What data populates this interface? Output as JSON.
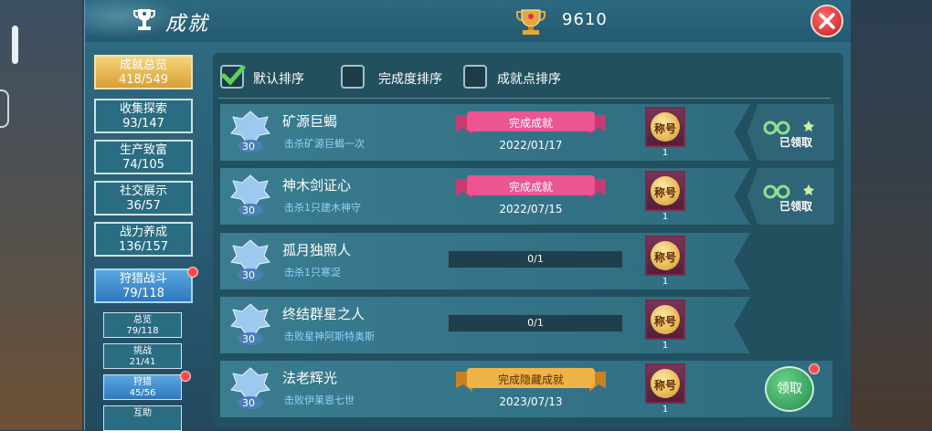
{
  "header": {
    "title": "成就",
    "points": "9610"
  },
  "categories": [
    {
      "label": "成就总览",
      "count": "418/549",
      "active": true
    },
    {
      "label": "收集探索",
      "count": "93/147"
    },
    {
      "label": "生产致富",
      "count": "74/105"
    },
    {
      "label": "社交展示",
      "count": "36/57"
    },
    {
      "label": "战力养成",
      "count": "136/157"
    },
    {
      "label": "狩猎战斗",
      "count": "79/118",
      "badge": true
    }
  ],
  "subcategories": [
    {
      "label": "总览",
      "count": "79/118"
    },
    {
      "label": "挑战",
      "count": "21/41"
    },
    {
      "label": "狩猎",
      "count": "45/56",
      "active": true,
      "badge": true
    },
    {
      "label": "互助",
      "count": ""
    }
  ],
  "sort_options": [
    {
      "label": "默认排序",
      "checked": true
    },
    {
      "label": "完成度排序",
      "checked": false
    },
    {
      "label": "成就点排序",
      "checked": false
    }
  ],
  "achievements": [
    {
      "name": "矿源巨蝎",
      "desc": "击杀矿源巨蝎一次",
      "badge_points": "30",
      "status": "完成成就",
      "date": "2022/01/17",
      "progress": "",
      "progress_value": 1,
      "title_item": "称号",
      "title_count": "1",
      "reward": "已领取"
    },
    {
      "name": "神木剑证心",
      "desc": "击杀1只建木神守",
      "badge_points": "30",
      "status": "完成成就",
      "date": "2022/07/15",
      "progress": "",
      "progress_value": 1,
      "title_item": "称号",
      "title_count": "1",
      "reward": "已领取"
    },
    {
      "name": "孤月独照人",
      "desc": "击杀1只寒浞",
      "badge_points": "30",
      "status": "",
      "date": "",
      "progress": "0/1",
      "progress_value": 0,
      "title_item": "称号",
      "title_count": "1",
      "reward": ""
    },
    {
      "name": "终结群星之人",
      "desc": "击败星神阿斯特奥斯",
      "badge_points": "30",
      "status": "",
      "date": "",
      "progress": "0/1",
      "progress_value": 0,
      "title_item": "称号",
      "title_count": "1",
      "reward": ""
    },
    {
      "name": "法老辉光",
      "desc": "击败伊莱恩七世",
      "badge_points": "30",
      "status": "完成隐藏成就",
      "date": "2023/07/13",
      "progress": "",
      "progress_value": 1,
      "title_item": "称号",
      "title_count": "1",
      "reward": "领取"
    }
  ],
  "colors": {
    "ribbon_pink": "#e84d8a",
    "ribbon_gold": "#e8a63a",
    "claim_green": "#3fb765"
  }
}
